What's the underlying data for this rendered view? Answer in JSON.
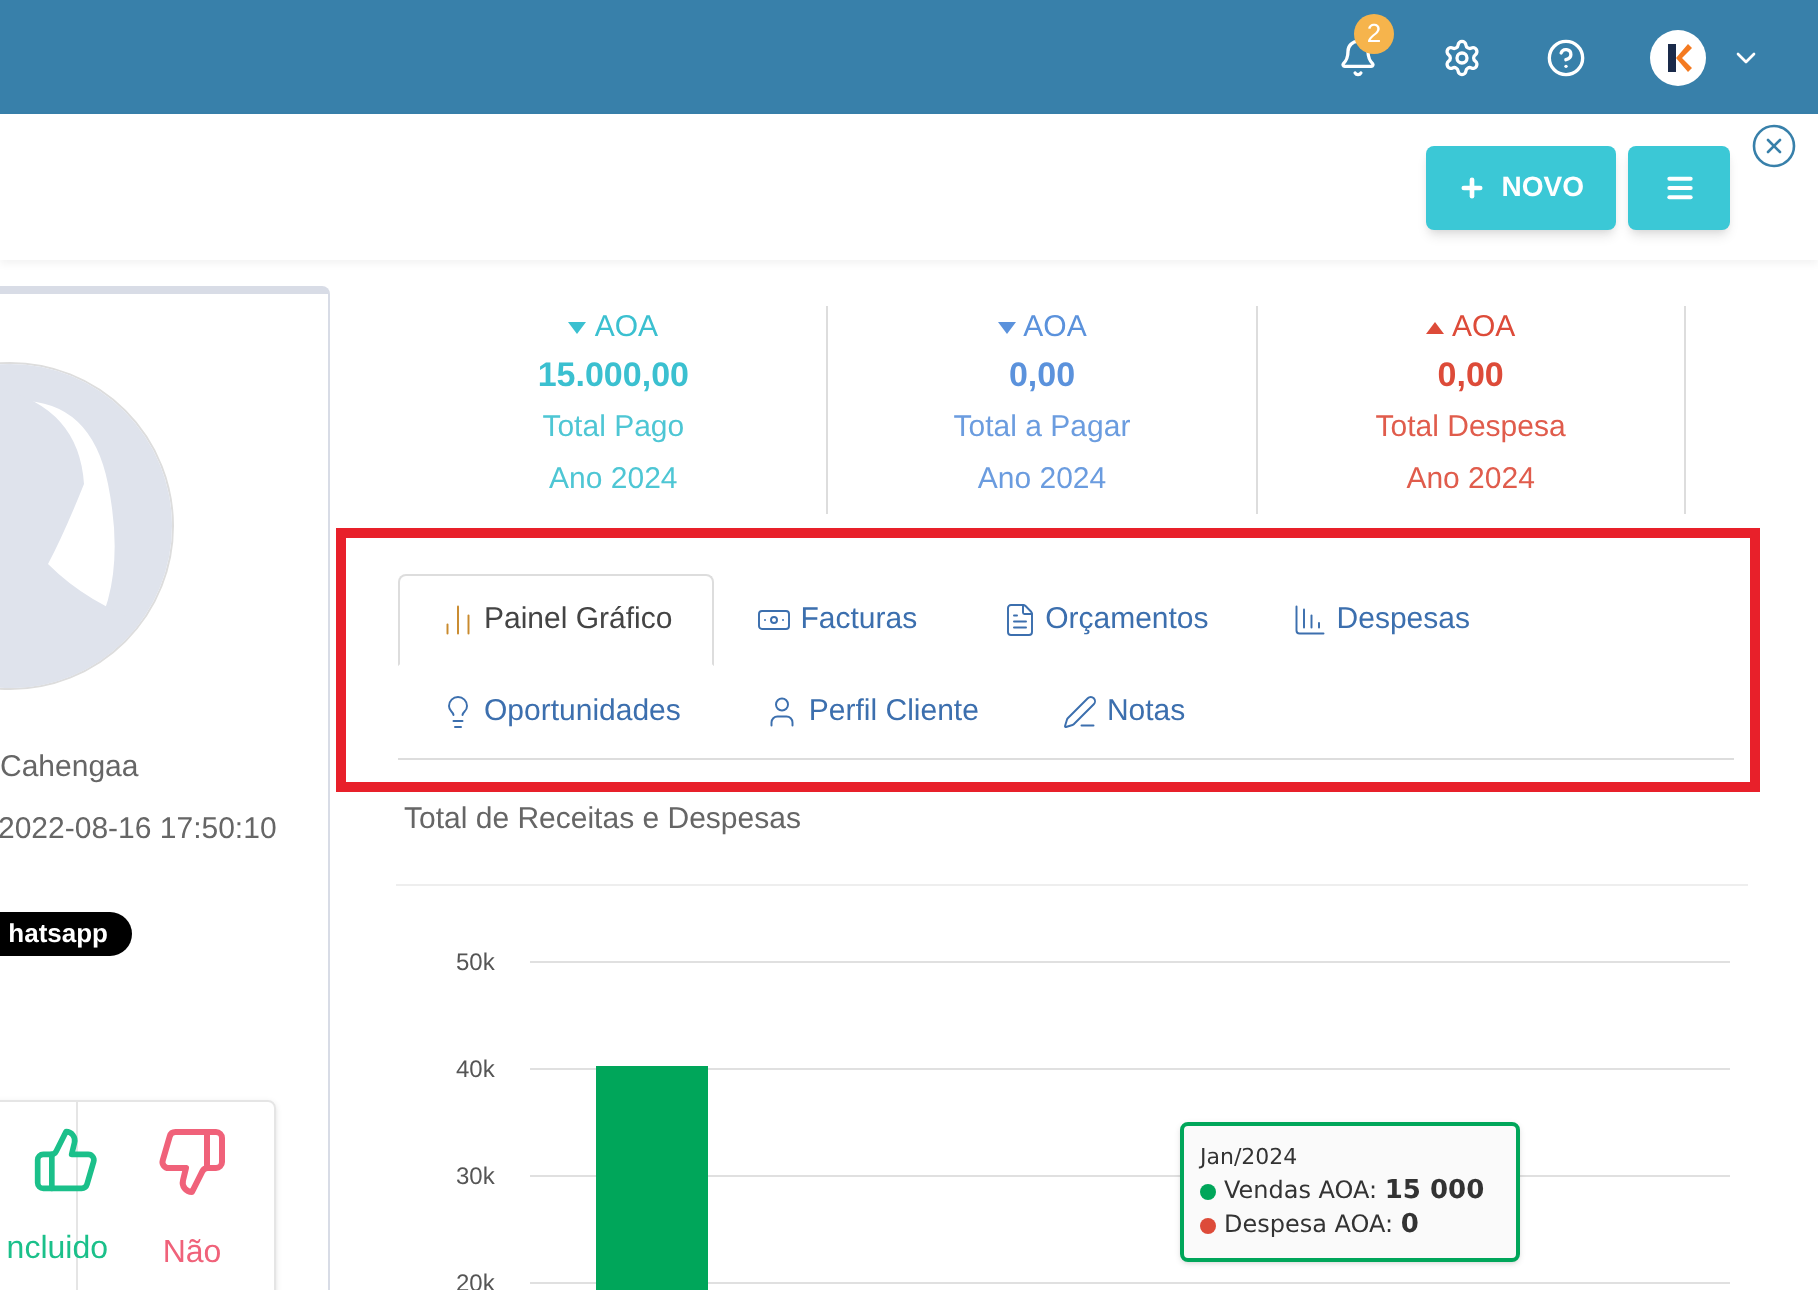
{
  "header": {
    "notification_count": "2"
  },
  "toolbar": {
    "new_button": "NOVO"
  },
  "client": {
    "name": "Cahengaa",
    "date": "2022-08-16 17:50:10",
    "whatsapp": "hatsapp",
    "included": "ncluido",
    "not_included": "Não"
  },
  "stats": [
    {
      "kind": "down",
      "color": "#3bc0d0",
      "currency": "AOA",
      "amount": "15.000,00",
      "label": "Total Pago",
      "year": "Ano 2024"
    },
    {
      "kind": "down",
      "color": "#5b92dc",
      "currency": "AOA",
      "amount": "0,00",
      "label": "Total a Pagar",
      "year": "Ano 2024"
    },
    {
      "kind": "up",
      "color": "#dd4b39",
      "currency": "AOA",
      "amount": "0,00",
      "label": "Total Despesa",
      "year": "Ano 2024"
    }
  ],
  "tabs": [
    {
      "kind": "chart",
      "label": "Painel Gráfico",
      "selected": true
    },
    {
      "kind": "money",
      "label": "Facturas",
      "selected": false
    },
    {
      "kind": "file",
      "label": "Orçamentos",
      "selected": false
    },
    {
      "kind": "bars",
      "label": "Despesas",
      "selected": false
    },
    {
      "kind": "bulb",
      "label": "Oportunidades",
      "selected": false
    },
    {
      "kind": "user",
      "label": "Perfil Cliente",
      "selected": false
    },
    {
      "kind": "pen",
      "label": "Notas",
      "selected": false
    }
  ],
  "chart": {
    "title": "Total de Receitas e Despesas",
    "y_axis_labels": [
      "50k",
      "40k",
      "30k",
      "20k"
    ],
    "tooltip": {
      "title": "Jan/2024",
      "items": [
        {
          "label": "Vendas AOA: ",
          "value": "15 000",
          "color": "#00a65a"
        },
        {
          "label": "Despesa AOA: ",
          "value": "0",
          "color": "#dd4b39"
        }
      ]
    }
  }
}
